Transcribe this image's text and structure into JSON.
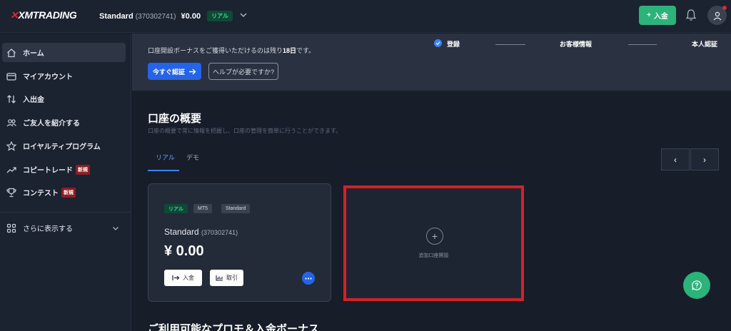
{
  "header": {
    "logo": "XMTRADING",
    "account_type": "Standard",
    "account_number": "(370302741)",
    "balance": "¥0.00",
    "account_badge": "リアル",
    "deposit_label": "入金"
  },
  "sidebar": {
    "items": [
      {
        "label": "ホーム",
        "icon": "home-icon",
        "active": true
      },
      {
        "label": "マイアカウント",
        "icon": "wallet-icon"
      },
      {
        "label": "入出金",
        "icon": "transfer-icon"
      },
      {
        "label": "ご友人を紹介する",
        "icon": "users-icon"
      },
      {
        "label": "ロイヤルティプログラム",
        "icon": "star-icon"
      },
      {
        "label": "コピートレード",
        "icon": "trend-icon",
        "badge": "新規"
      },
      {
        "label": "コンテスト",
        "icon": "trophy-icon",
        "badge": "新規"
      }
    ],
    "more_label": "さらに表示する"
  },
  "banner": {
    "text_prefix": "口座開設ボーナスをご獲得いただけるのは残り",
    "days": "18日",
    "text_suffix": "です。",
    "verify_label": "今すぐ認証",
    "help_label": "ヘルプが必要ですか?",
    "steps": [
      "登録",
      "お客様情報",
      "本人認証"
    ]
  },
  "main": {
    "title": "口座の概要",
    "subtitle": "口座の概要で常に情報を把握し、口座の管理を簡単に行うことができます。",
    "tabs": [
      "リアル",
      "デモ"
    ],
    "prev": "‹",
    "next": "›"
  },
  "card": {
    "tags": [
      "リアル",
      "MT5",
      "Standard"
    ],
    "name": "Standard",
    "number": "(370302741)",
    "balance": "¥ 0.00",
    "deposit_label": "入金",
    "trade_label": "取引"
  },
  "add_account": {
    "label": "追加口座開設"
  },
  "bottom": {
    "title": "ご利用可能なプロモ＆入金ボーナス"
  },
  "colors": {
    "accent": "#2563e8",
    "green": "#2bb37a",
    "highlight": "#d42027"
  }
}
